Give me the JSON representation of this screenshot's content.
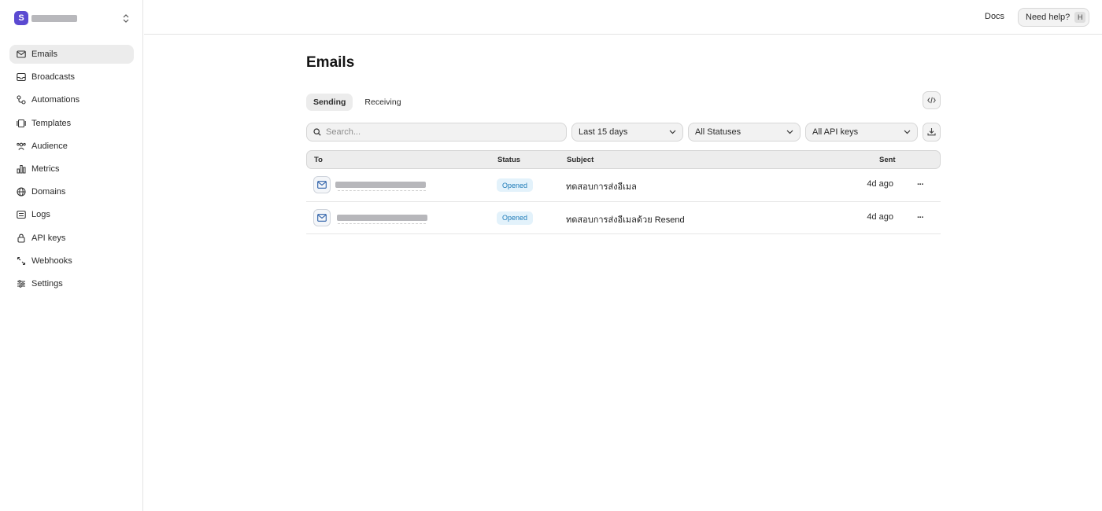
{
  "team": {
    "initial": "S"
  },
  "sidebar": {
    "items": [
      {
        "label": "Emails",
        "icon": "mail-icon",
        "active": true
      },
      {
        "label": "Broadcasts",
        "icon": "inbox-icon"
      },
      {
        "label": "Automations",
        "icon": "workflow-icon"
      },
      {
        "label": "Templates",
        "icon": "template-icon"
      },
      {
        "label": "Audience",
        "icon": "users-icon"
      },
      {
        "label": "Metrics",
        "icon": "bar-chart-icon"
      },
      {
        "label": "Domains",
        "icon": "globe-icon"
      },
      {
        "label": "Logs",
        "icon": "list-icon"
      },
      {
        "label": "API keys",
        "icon": "lock-icon"
      },
      {
        "label": "Webhooks",
        "icon": "webhook-icon"
      },
      {
        "label": "Settings",
        "icon": "sliders-icon"
      }
    ]
  },
  "topbar": {
    "docs_label": "Docs",
    "help_label": "Need help?",
    "help_shortcut": "H"
  },
  "page": {
    "title": "Emails"
  },
  "tabs": [
    {
      "label": "Sending",
      "active": true
    },
    {
      "label": "Receiving"
    }
  ],
  "filters": {
    "search_placeholder": "Search...",
    "date_range": "Last 15 days",
    "status": "All Statuses",
    "api_keys": "All API keys"
  },
  "table": {
    "headers": {
      "to": "To",
      "status": "Status",
      "subject": "Subject",
      "sent": "Sent"
    },
    "rows": [
      {
        "status": "Opened",
        "subject": "ทดสอบการส่งอีเมล",
        "sent": "4d ago"
      },
      {
        "status": "Opened",
        "subject": "ทดสอบการส่งอีเมลด้วย Resend",
        "sent": "4d ago"
      }
    ]
  },
  "colors": {
    "accent": "#5b4ad1",
    "badge_bg": "#e3f2fb",
    "badge_text": "#1e7bb8"
  }
}
